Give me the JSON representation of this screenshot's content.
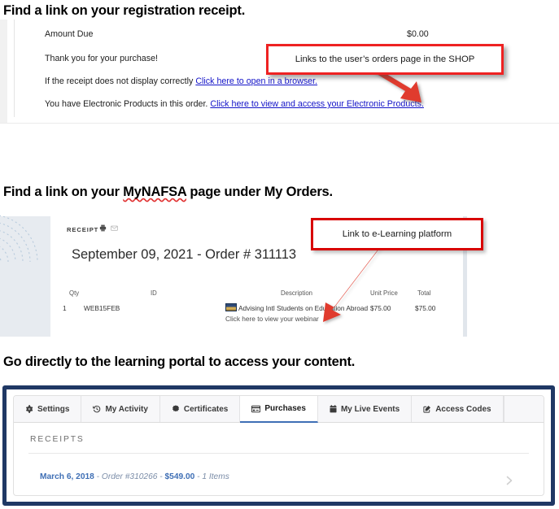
{
  "sections": [
    {
      "heading": "Find a link on your registration receipt.",
      "email_receipt": {
        "amount_due_label": "Amount Due",
        "amount_due_value": "$0.00",
        "thanks": "Thank you for your purchase!",
        "line3_prefix": "If the receipt does not display correctly ",
        "line3_link": "Click here to open in a browser.",
        "line4_prefix": "You have Electronic Products in this order. ",
        "line4_link": "Click here to view and access your Electronic Products."
      },
      "callout": {
        "text": "Links to the user’s orders page in the SHOP",
        "border_color": "#ee2222",
        "arrow_color": "#e03b2e"
      }
    },
    {
      "heading_part1": "Find a link on your ",
      "heading_misspelled": "MyNAFSA",
      "heading_part2": " page under My Orders.",
      "order_panel": {
        "receipt_label": "RECEIPT",
        "print_icon": "print-icon",
        "mail_icon": "envelope-icon",
        "order_title": "September 09, 2021 - Order # 311113",
        "table": {
          "headers": [
            "Qty",
            "ID",
            "Description",
            "Unit Price",
            "Total"
          ],
          "rows": [
            {
              "qty": "1",
              "id": "WEB15FEB",
              "description": "Advising Intl Students on Education Abroad",
              "sub_link": "Click here to view your webinar",
              "unit_price": "$75.00",
              "total": "$75.00"
            }
          ]
        }
      },
      "callout": {
        "text": "Link to e-Learning platform",
        "border_color": "#d80000",
        "arrow_color": "#e03b2e"
      }
    },
    {
      "heading": "Go directly to the learning portal to access your content.",
      "portal": {
        "border_color": "#1f3864",
        "accent_color": "#3f6fb5",
        "tabs": [
          {
            "label": "Settings",
            "icon": "gear-icon",
            "active": false
          },
          {
            "label": "My Activity",
            "icon": "history-icon",
            "active": false
          },
          {
            "label": "Certificates",
            "icon": "certificate-icon",
            "active": false
          },
          {
            "label": "Purchases",
            "icon": "credit-card-icon",
            "active": true
          },
          {
            "label": "My Live Events",
            "icon": "calendar-icon",
            "active": false
          },
          {
            "label": "Access Codes",
            "icon": "pen-square-icon",
            "active": false
          }
        ],
        "receipts_title": "RECEIPTS",
        "receipts": [
          {
            "date": "March 6, 2018",
            "sep1": " - ",
            "order": "Order #310266",
            "sep2": " - ",
            "amount": "$549.00",
            "sep3": " - ",
            "items": "1 Items",
            "chevron": "chevron-right-icon"
          }
        ]
      }
    }
  ]
}
